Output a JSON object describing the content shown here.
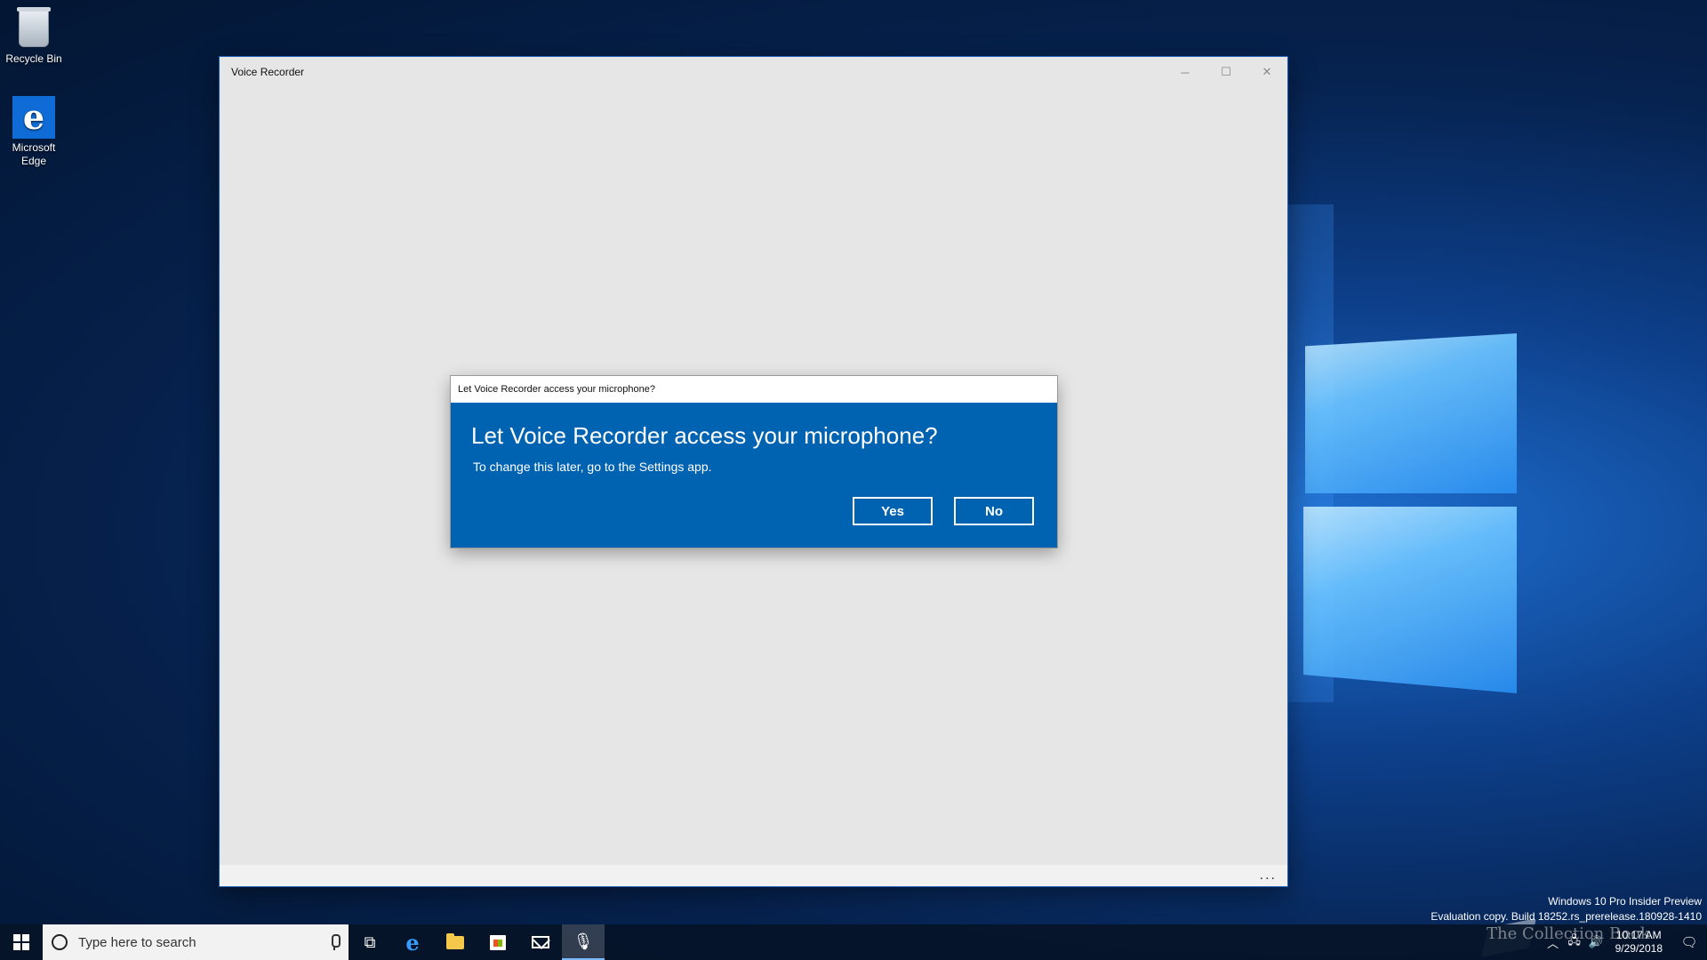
{
  "desktop": {
    "icons": [
      {
        "label": "Recycle Bin",
        "icon": "recycle-bin-icon"
      },
      {
        "label": "Microsoft Edge",
        "icon": "edge-icon"
      }
    ]
  },
  "window": {
    "title": "Voice Recorder",
    "controls": {
      "minimize": "─",
      "maximize": "☐",
      "close": "✕"
    },
    "more_menu": "..."
  },
  "dialog": {
    "titlebar": "Let Voice Recorder access your microphone?",
    "heading": "Let Voice Recorder access your microphone?",
    "message": "To change this later, go to the Settings app.",
    "yes_label": "Yes",
    "no_label": "No",
    "accent_color": "#0063b1"
  },
  "watermark": {
    "line1": "Windows 10 Pro Insider Preview",
    "line2": "Evaluation copy. Build 18252.rs_prerelease.180928-1410",
    "brand": "The Collection Book"
  },
  "taskbar": {
    "search_placeholder": "Type here to search",
    "apps": [
      "task-view-icon",
      "edge-icon",
      "file-explorer-icon",
      "store-icon",
      "mail-icon",
      "voice-recorder-icon"
    ],
    "clock_time": "10:17 AM",
    "clock_date": "9/29/2018"
  }
}
